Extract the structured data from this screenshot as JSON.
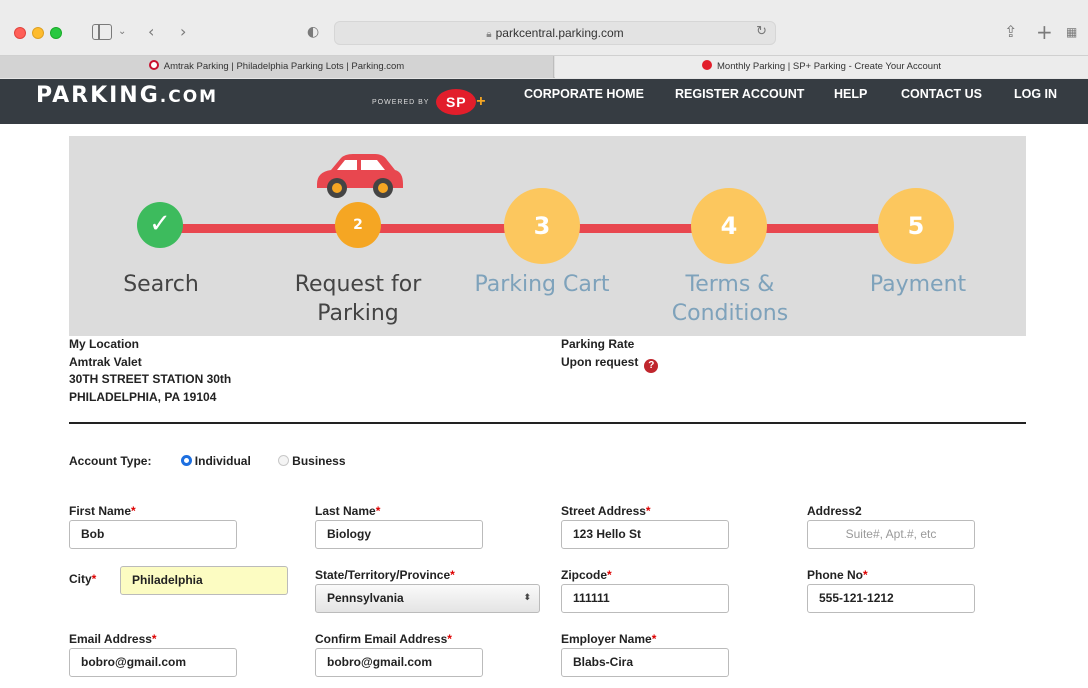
{
  "browser": {
    "url": "parkcentral.parking.com",
    "tabs": [
      {
        "label": "Amtrak Parking | Philadelphia Parking Lots | Parking.com"
      },
      {
        "label": "Monthly Parking | SP+ Parking - Create Your Account"
      }
    ]
  },
  "site": {
    "logo_main": "ARKING",
    "logo_initial": "P",
    "logo_suffix": ".COM",
    "powered_by": "POWERED BY",
    "sp_badge": "SP",
    "sp_plus": "+",
    "nav": [
      "CORPORATE HOME",
      "REGISTER ACCOUNT",
      "HELP",
      "CONTACT US",
      "LOG IN"
    ]
  },
  "steps": [
    {
      "number": "✓",
      "label": "Search"
    },
    {
      "number": "2",
      "label": "Request for Parking"
    },
    {
      "number": "3",
      "label": "Parking Cart"
    },
    {
      "number": "4",
      "label": "Terms & Conditions"
    },
    {
      "number": "5",
      "label": "Payment"
    }
  ],
  "location": {
    "heading": "My Location",
    "name": "Amtrak Valet",
    "street": "30TH STREET STATION 30th",
    "city": "PHILADELPHIA, PA 19104"
  },
  "rate": {
    "heading": "Parking Rate",
    "value": "Upon request",
    "help_icon": "?"
  },
  "account_type": {
    "label": "Account Type:",
    "options": [
      "Individual",
      "Business"
    ],
    "selected": "Individual"
  },
  "form": {
    "first_name": {
      "label": "First Name",
      "value": "Bob"
    },
    "last_name": {
      "label": "Last Name",
      "value": "Biology"
    },
    "street": {
      "label": "Street Address",
      "value": "123 Hello St"
    },
    "address2": {
      "label": "Address2",
      "placeholder": "Suite#, Apt.#, etc"
    },
    "city": {
      "label": "City",
      "value": "Philadelphia"
    },
    "state": {
      "label": "State/Territory/Province",
      "value": "Pennsylvania"
    },
    "zip": {
      "label": "Zipcode",
      "value": "111111"
    },
    "phone": {
      "label": "Phone No",
      "value": "555-121-1212"
    },
    "email": {
      "label": "Email Address",
      "value": "bobro@gmail.com"
    },
    "confirm_email": {
      "label": "Confirm Email Address",
      "value": "bobro@gmail.com"
    },
    "employer": {
      "label": "Employer Name",
      "value": "Blabs-Cira"
    },
    "required_mark": "*"
  },
  "colors": {
    "nav_bg": "#363c42",
    "accent_red": "#e8474f",
    "step_done": "#3dbb5d",
    "step_active": "#f5a623",
    "step_pending": "#fcc75e"
  }
}
